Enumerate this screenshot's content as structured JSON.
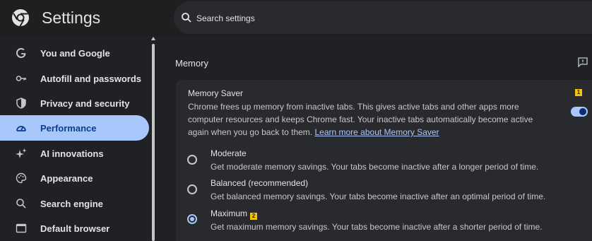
{
  "header": {
    "title": "Settings",
    "search": {
      "placeholder": "Search settings"
    }
  },
  "sidebar": {
    "items": [
      {
        "label": "You and Google",
        "icon": "google-g-icon"
      },
      {
        "label": "Autofill and passwords",
        "icon": "key-icon"
      },
      {
        "label": "Privacy and security",
        "icon": "shield-icon"
      },
      {
        "label": "Performance",
        "icon": "speedometer-icon",
        "active": true
      },
      {
        "label": "AI innovations",
        "icon": "sparkle-icon"
      },
      {
        "label": "Appearance",
        "icon": "palette-icon"
      },
      {
        "label": "Search engine",
        "icon": "search-icon"
      },
      {
        "label": "Default browser",
        "icon": "browser-window-icon"
      }
    ]
  },
  "main": {
    "section_title": "Memory",
    "card": {
      "title": "Memory Saver",
      "description": "Chrome frees up memory from inactive tabs. This gives active tabs and other apps more computer resources and keeps Chrome fast. Your inactive tabs automatically become active again when you go back to them.",
      "link": "Learn more about Memory Saver",
      "toggle_on": true,
      "markers": [
        "1",
        "2"
      ],
      "options": [
        {
          "label": "Moderate",
          "desc": "Get moderate memory savings. Your tabs become inactive after a longer period of time.",
          "checked": false
        },
        {
          "label": "Balanced (recommended)",
          "desc": "Get balanced memory savings. Your tabs become inactive after an optimal period of time.",
          "checked": false
        },
        {
          "label": "Maximum",
          "desc": "Get maximum memory savings. Your tabs become inactive after a shorter period of time.",
          "checked": true
        }
      ]
    }
  },
  "colors": {
    "background": "#202124",
    "accent": "#a8c7fa",
    "active_text": "#0b3d91",
    "marker": "#f4c20d"
  }
}
